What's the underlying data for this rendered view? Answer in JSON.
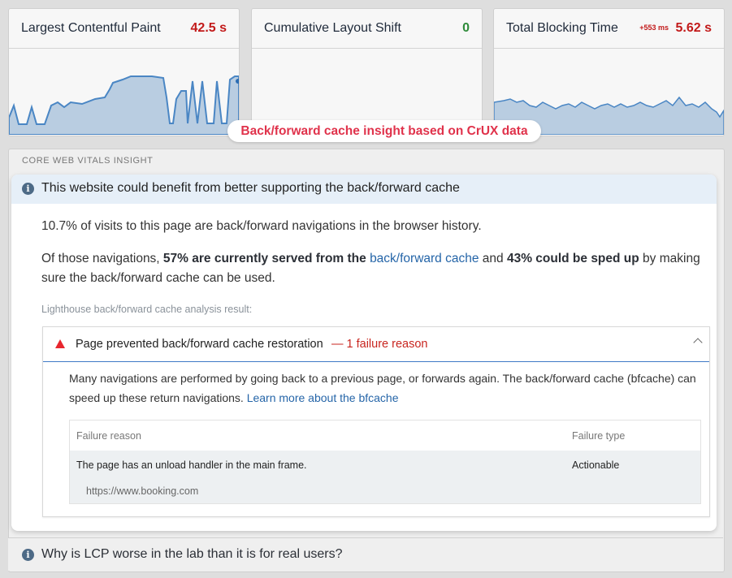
{
  "metrics": [
    {
      "title": "Largest Contentful Paint",
      "value": "42.5 s",
      "status_color": "#c21a1a"
    },
    {
      "title": "Cumulative Layout Shift",
      "value": "0",
      "status_color": "#2e8b3a"
    },
    {
      "title": "Total Blocking Time",
      "delta": "+553 ms",
      "value": "5.62 s",
      "status_color": "#c21a1a"
    }
  ],
  "banner": "Back/forward cache insight based on CrUX data",
  "panel_title": "CORE WEB VITALS INSIGHT",
  "insight": {
    "icon": "info-icon",
    "heading": "This website could benefit from better supporting the back/forward cache",
    "p1": "10.7% of visits to this page are back/forward navigations in the browser history.",
    "p2": {
      "t1": "Of those navigations, ",
      "b1": "57% are currently served from the ",
      "link": "back/forward cache",
      "t2": " and ",
      "b2": "43% could be sped up",
      "t3": " by making sure the back/forward cache can be used."
    },
    "sub": "Lighthouse back/forward cache analysis result:"
  },
  "audit": {
    "icon": "warning-triangle-icon",
    "title": "Page prevented back/forward cache restoration",
    "fail": "— 1 failure reason",
    "desc": "Many navigations are performed by going back to a previous page, or forwards again. The back/forward cache (bfcache) can speed up these return navigations.",
    "desc_link": "Learn more about the bfcache",
    "table": {
      "col1": "Failure reason",
      "col2": "Failure type",
      "rows": [
        {
          "reason": "The page has an unload handler in the main frame.",
          "type": "Actionable",
          "url": "https://www.booking.com"
        }
      ]
    }
  },
  "faq": {
    "icon": "info-icon",
    "text": "Why is LCP worse in the lab than it is for real users?"
  },
  "colors": {
    "chart_line": "#4a86c4",
    "chart_fill": "#b9cde1",
    "warn": "#e8262e",
    "accent": "#e0324b"
  }
}
